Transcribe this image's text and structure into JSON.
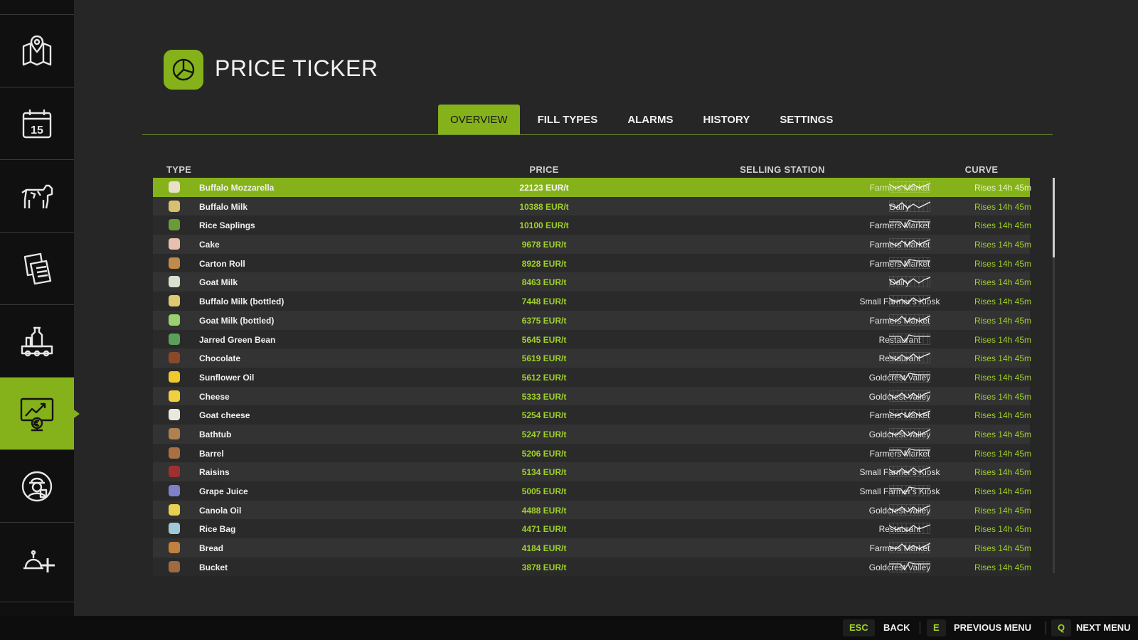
{
  "header": {
    "title": "PRICE TICKER"
  },
  "tabs": [
    {
      "label": "OVERVIEW",
      "active": true
    },
    {
      "label": "FILL TYPES",
      "active": false
    },
    {
      "label": "ALARMS",
      "active": false
    },
    {
      "label": "HISTORY",
      "active": false
    },
    {
      "label": "SETTINGS",
      "active": false
    }
  ],
  "columns": {
    "type": "TYPE",
    "price": "PRICE",
    "station": "SELLING STATION",
    "curve": "CURVE"
  },
  "sidebar": {
    "items": [
      {
        "icon": "map-icon"
      },
      {
        "icon": "calendar-icon",
        "text": "15"
      },
      {
        "icon": "cow-icon"
      },
      {
        "icon": "contracts-icon"
      },
      {
        "icon": "production-icon"
      },
      {
        "icon": "price-chart-icon",
        "active": true
      },
      {
        "icon": "farmer-icon"
      },
      {
        "icon": "help-icon"
      }
    ]
  },
  "rows": [
    {
      "name": "Buffalo Mozzarella",
      "price": "22123 EUR/t",
      "station": "Farmers Market",
      "trend": "Rises 14h 45m",
      "color": "#e8e0c8"
    },
    {
      "name": "Buffalo Milk",
      "price": "10388 EUR/t",
      "station": "Dairy",
      "trend": "Rises 14h 45m",
      "color": "#d8c070"
    },
    {
      "name": "Rice Saplings",
      "price": "10100 EUR/t",
      "station": "Farmers Market",
      "trend": "Rises 14h 45m",
      "color": "#6a9a3a"
    },
    {
      "name": "Cake",
      "price": "9678 EUR/t",
      "station": "Farmers Market",
      "trend": "Rises 14h 45m",
      "color": "#e8c0b0"
    },
    {
      "name": "Carton Roll",
      "price": "8928 EUR/t",
      "station": "Farmers Market",
      "trend": "Rises 14h 45m",
      "color": "#c08a4a"
    },
    {
      "name": "Goat Milk",
      "price": "8463 EUR/t",
      "station": "Dairy",
      "trend": "Rises 14h 45m",
      "color": "#d8e0d0"
    },
    {
      "name": "Buffalo Milk (bottled)",
      "price": "7448 EUR/t",
      "station": "Small Farmer's Kiosk",
      "trend": "Rises 14h 45m",
      "color": "#e0c870"
    },
    {
      "name": "Goat Milk (bottled)",
      "price": "6375 EUR/t",
      "station": "Farmers Market",
      "trend": "Rises 14h 45m",
      "color": "#9ad070"
    },
    {
      "name": "Jarred Green Bean",
      "price": "5645 EUR/t",
      "station": "Restaurant",
      "trend": "Rises 14h 45m",
      "color": "#5aa05a"
    },
    {
      "name": "Chocolate",
      "price": "5619 EUR/t",
      "station": "Restaurant",
      "trend": "Rises 14h 45m",
      "color": "#8a4a2a"
    },
    {
      "name": "Sunflower Oil",
      "price": "5612 EUR/t",
      "station": "Goldcrest Valley",
      "trend": "Rises 14h 45m",
      "color": "#f0c830"
    },
    {
      "name": "Cheese",
      "price": "5333 EUR/t",
      "station": "Goldcrest Valley",
      "trend": "Rises 14h 45m",
      "color": "#f0d040"
    },
    {
      "name": "Goat cheese",
      "price": "5254 EUR/t",
      "station": "Farmers Market",
      "trend": "Rises 14h 45m",
      "color": "#e8e8e0"
    },
    {
      "name": "Bathtub",
      "price": "5247 EUR/t",
      "station": "Goldcrest Valley",
      "trend": "Rises 14h 45m",
      "color": "#b08050"
    },
    {
      "name": "Barrel",
      "price": "5206 EUR/t",
      "station": "Farmers Market",
      "trend": "Rises 14h 45m",
      "color": "#a87040"
    },
    {
      "name": "Raisins",
      "price": "5134 EUR/t",
      "station": "Small Farmer's Kiosk",
      "trend": "Rises 14h 45m",
      "color": "#a03030"
    },
    {
      "name": "Grape Juice",
      "price": "5005 EUR/t",
      "station": "Small Farmer's Kiosk",
      "trend": "Rises 14h 45m",
      "color": "#8080c8"
    },
    {
      "name": "Canola Oil",
      "price": "4488 EUR/t",
      "station": "Goldcrest Valley",
      "trend": "Rises 14h 45m",
      "color": "#e8d050"
    },
    {
      "name": "Rice Bag",
      "price": "4471 EUR/t",
      "station": "Restaurant",
      "trend": "Rises 14h 45m",
      "color": "#a0c8d8"
    },
    {
      "name": "Bread",
      "price": "4184 EUR/t",
      "station": "Farmers Market",
      "trend": "Rises 14h 45m",
      "color": "#c08040"
    },
    {
      "name": "Bucket",
      "price": "3878 EUR/t",
      "station": "Goldcrest Valley",
      "trend": "Rises 14h 45m",
      "color": "#a06a40"
    }
  ],
  "footer": {
    "back": {
      "key": "ESC",
      "label": "BACK"
    },
    "prev": {
      "key": "E",
      "label": "PREVIOUS MENU"
    },
    "next": {
      "key": "Q",
      "label": "NEXT MENU"
    }
  },
  "colors": {
    "accent": "#85b21a",
    "price_green": "#9fd02a"
  }
}
